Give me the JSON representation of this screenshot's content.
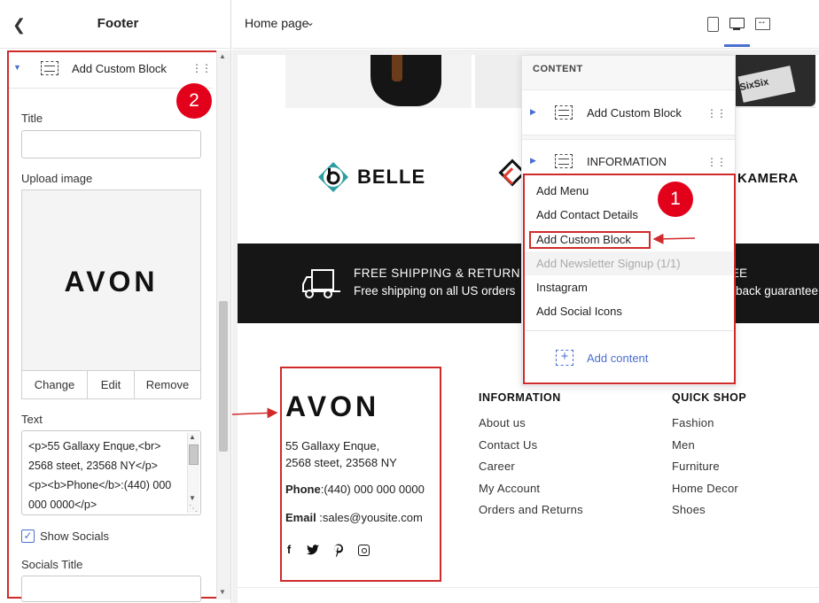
{
  "panel": {
    "title": "Footer",
    "block_label": "Add Custom Block",
    "badge": "2",
    "title_label": "Title",
    "title_value": "",
    "upload_label": "Upload image",
    "image_logo": "AVON",
    "image_buttons": [
      "Change",
      "Edit",
      "Remove"
    ],
    "text_label": "Text",
    "text_value": "<p>55 Gallaxy Enque,<br>\n2568 steet, 23568 NY</p>\n<p><b>Phone</b>:(440) 000\n000 0000</p>",
    "show_socials_label": "Show Socials",
    "show_socials_checked": true,
    "socials_title_label": "Socials Title"
  },
  "toolbar": {
    "page_select": "Home page",
    "device_active": "desktop"
  },
  "preview": {
    "brand_belle": "BELLE",
    "brand_kamera": "KAMERA",
    "bag_text": "SixSix",
    "shipping_title": "FREE SHIPPING & RETURN",
    "shipping_sub": "Free shipping on all US orders",
    "shipping2_title": "EE",
    "shipping2_sub": "back guarantee",
    "footer_logo": "AVON",
    "footer_address_1": "55 Gallaxy Enque,",
    "footer_address_2": "2568 steet, 23568 NY",
    "footer_phone_label": "Phone",
    "footer_phone_value": ":(440) 000 000 0000",
    "footer_email_label": "Email",
    "footer_email_value": " :sales@yousite.com",
    "info_heading": "INFORMATION",
    "info_links": [
      "About us",
      "Contact Us",
      "Career",
      "My Account",
      "Orders and Returns"
    ],
    "quick_heading": "QUICK SHOP",
    "quick_links": [
      "Fashion",
      "Men",
      "Furniture",
      "Home Decor",
      "Shoes"
    ]
  },
  "content_panel": {
    "heading": "CONTENT",
    "rows": [
      "Add Custom Block",
      "INFORMATION"
    ],
    "badge": "1",
    "menu": [
      "Add Menu",
      "Add Contact Details",
      "Add Custom Block",
      "Add Newsletter Signup (1/1)",
      "Instagram",
      "Add Social Icons"
    ],
    "add_content": "Add content"
  },
  "colors": {
    "accent": "#4a6fd0",
    "annotation_red": "#d12a2a",
    "badge_red": "#e3001b",
    "shipping_band": "#161616",
    "belle_teal": "#2f9ea3"
  }
}
